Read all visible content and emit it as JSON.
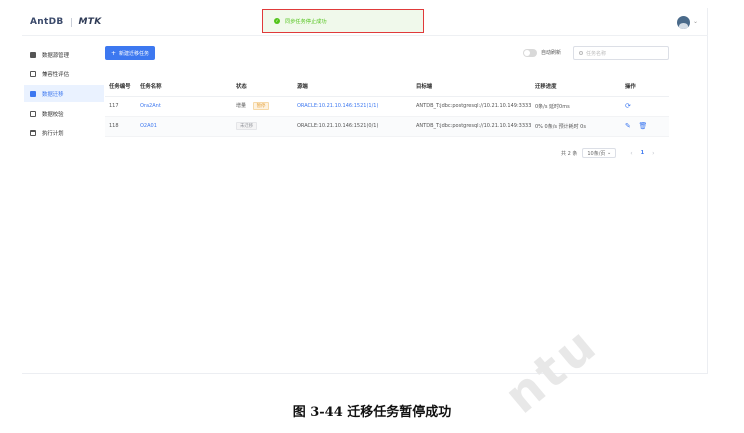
{
  "topbar": {
    "logo_left": "AntDB",
    "logo_right": "MTK"
  },
  "toast": {
    "message": "同步任务停止成功"
  },
  "sidebar": {
    "items": [
      {
        "label": "数据源管理",
        "icon": "database-icon"
      },
      {
        "label": "兼容性评估",
        "icon": "document-icon"
      },
      {
        "label": "数据迁移",
        "icon": "folder-icon",
        "active": true
      },
      {
        "label": "数据校验",
        "icon": "check-icon"
      },
      {
        "label": "执行计划",
        "icon": "calendar-icon"
      }
    ]
  },
  "toolbar": {
    "new_task": "新建迁移任务",
    "auto_refresh": "自动刷新",
    "search_placeholder": "任务名称"
  },
  "table": {
    "headers": [
      "任务编号",
      "任务名称",
      "状态",
      "源端",
      "目标端",
      "迁移进度",
      "操作"
    ],
    "rows": [
      {
        "id": "117",
        "name": "Ora2Ant",
        "status": "增量",
        "status_tag": "暂停",
        "source": "ORACLE:10.21.10.146:1521(1/1)",
        "target": "ANTDB_T:jdbc:postgresql://10.21.10.149:3333/",
        "progress": "0条/s 延时0ms"
      },
      {
        "id": "118",
        "name": "O2A01",
        "status": "",
        "status_tag": "未迁移",
        "source": "ORACLE:10.21.10.146:1521(0/1)",
        "target": "ANTDB_T:jdbc:postgresql://10.21.10.149:3333/",
        "progress": "0% 0条/s 预计耗时 0s"
      }
    ]
  },
  "pagination": {
    "total": "共 2 条",
    "page_size": "10条/页",
    "current": "1"
  },
  "caption": "图 3-44  迁移任务暂停成功",
  "colors": {
    "accent": "#3d78f0",
    "success": "#52c41a",
    "warning": "#e6a23c",
    "highlight_border": "#e03a3a"
  }
}
